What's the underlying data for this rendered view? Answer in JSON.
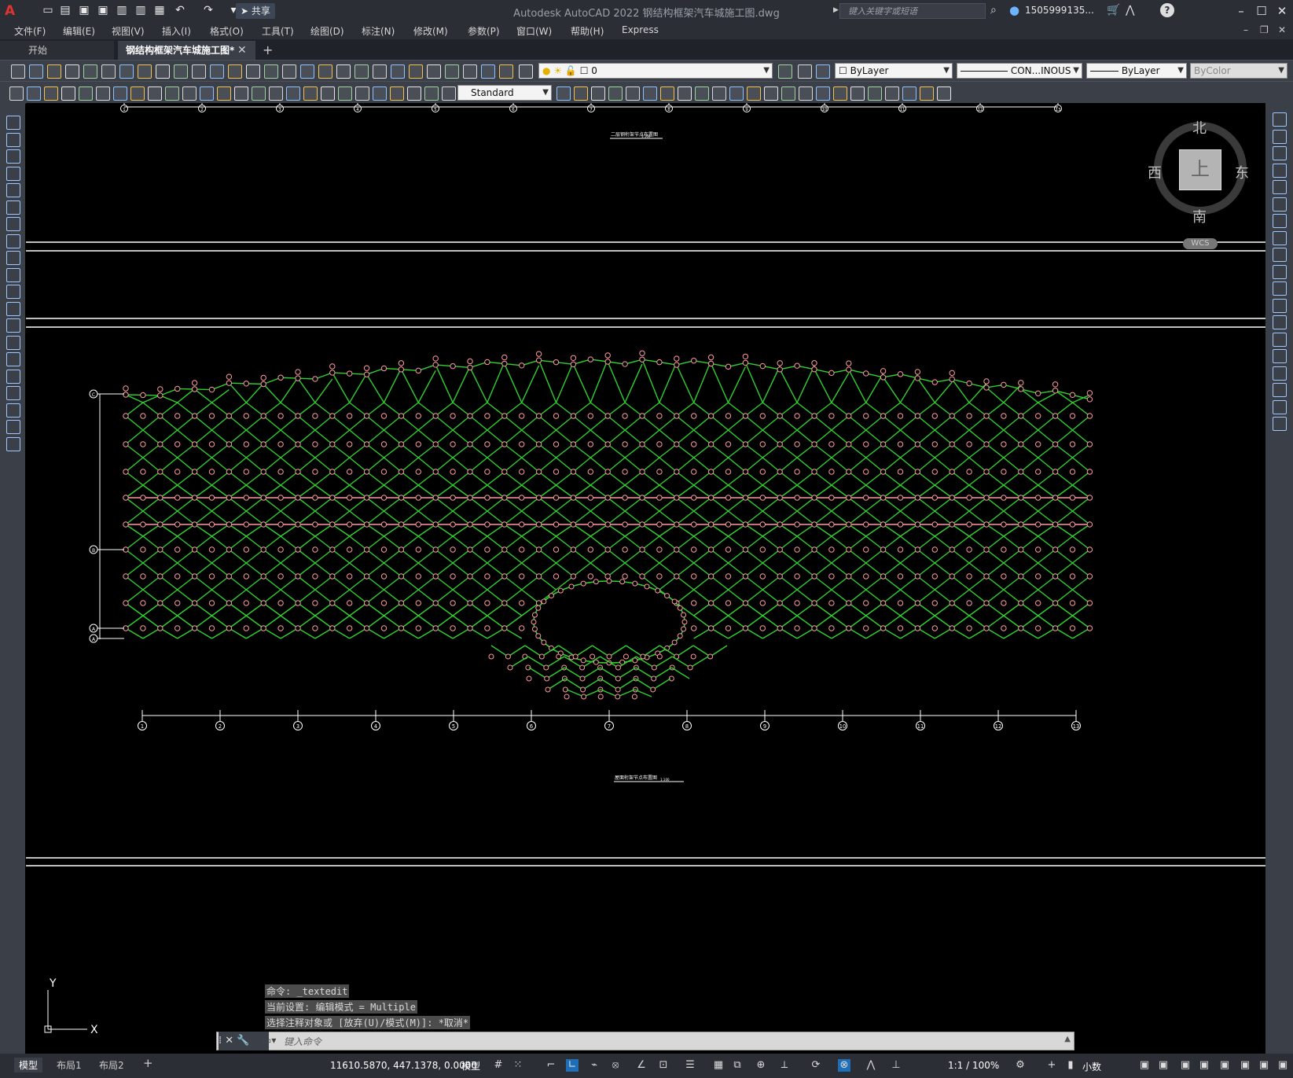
{
  "titlebar": {
    "app_logo": "A",
    "share": "共享",
    "title": "Autodesk AutoCAD 2022    钢结构框架汽车城施工图.dwg",
    "search_placeholder": "键入关键字或短语",
    "user": "1505999135..."
  },
  "menu": [
    "文件(F)",
    "编辑(E)",
    "视图(V)",
    "插入(I)",
    "格式(O)",
    "工具(T)",
    "绘图(D)",
    "标注(N)",
    "修改(M)",
    "参数(P)",
    "窗口(W)",
    "帮助(H)",
    "Express"
  ],
  "tabs": {
    "start": "开始",
    "drawing": "钢结构框架汽车城施工图*"
  },
  "toolbar": {
    "layer_value": "0",
    "color_value": "ByLayer",
    "linetype_value": "CON...INOUS",
    "lineweight_value": "ByLayer",
    "plotstyle_value": "ByColor",
    "textstyle_value": "Standard"
  },
  "viewcube": {
    "north": "北",
    "south": "南",
    "east": "东",
    "west": "西",
    "top": "上",
    "wcs": "WCS"
  },
  "drawing": {
    "top_axis_labels": [
      "1",
      "2",
      "3",
      "4",
      "5",
      "6",
      "7",
      "8",
      "9",
      "10",
      "11",
      "12",
      "13"
    ],
    "bottom_axis_labels": [
      "1",
      "2",
      "3",
      "4",
      "5",
      "6",
      "7",
      "8",
      "9",
      "10",
      "11",
      "12",
      "13"
    ],
    "left_axis_labels": [
      "C",
      "B",
      "A",
      "A"
    ],
    "top_caption": "二层钢桁架节点布置图",
    "bottom_caption": "屋面桁架节点布置图",
    "caption_scale": "1:100"
  },
  "ucs": {
    "x": "X",
    "y": "Y"
  },
  "command": {
    "history": [
      "命令: _textedit",
      "当前设置: 编辑模式 = Multiple",
      "选择注释对象或 [放弃(U)/模式(M)]: *取消*"
    ],
    "placeholder": "键入命令"
  },
  "statusbar": {
    "layout_tabs": [
      "模型",
      "布局1",
      "布局2"
    ],
    "coords": "11610.5870, 447.1378, 0.0000",
    "model": "模型",
    "scale": "1:1 / 100%",
    "units": "小数"
  },
  "colors": {
    "truss": "#2fd12f",
    "node": "#ff9aa0",
    "chord": "#ff9aa0",
    "axis": "#ffffff"
  }
}
